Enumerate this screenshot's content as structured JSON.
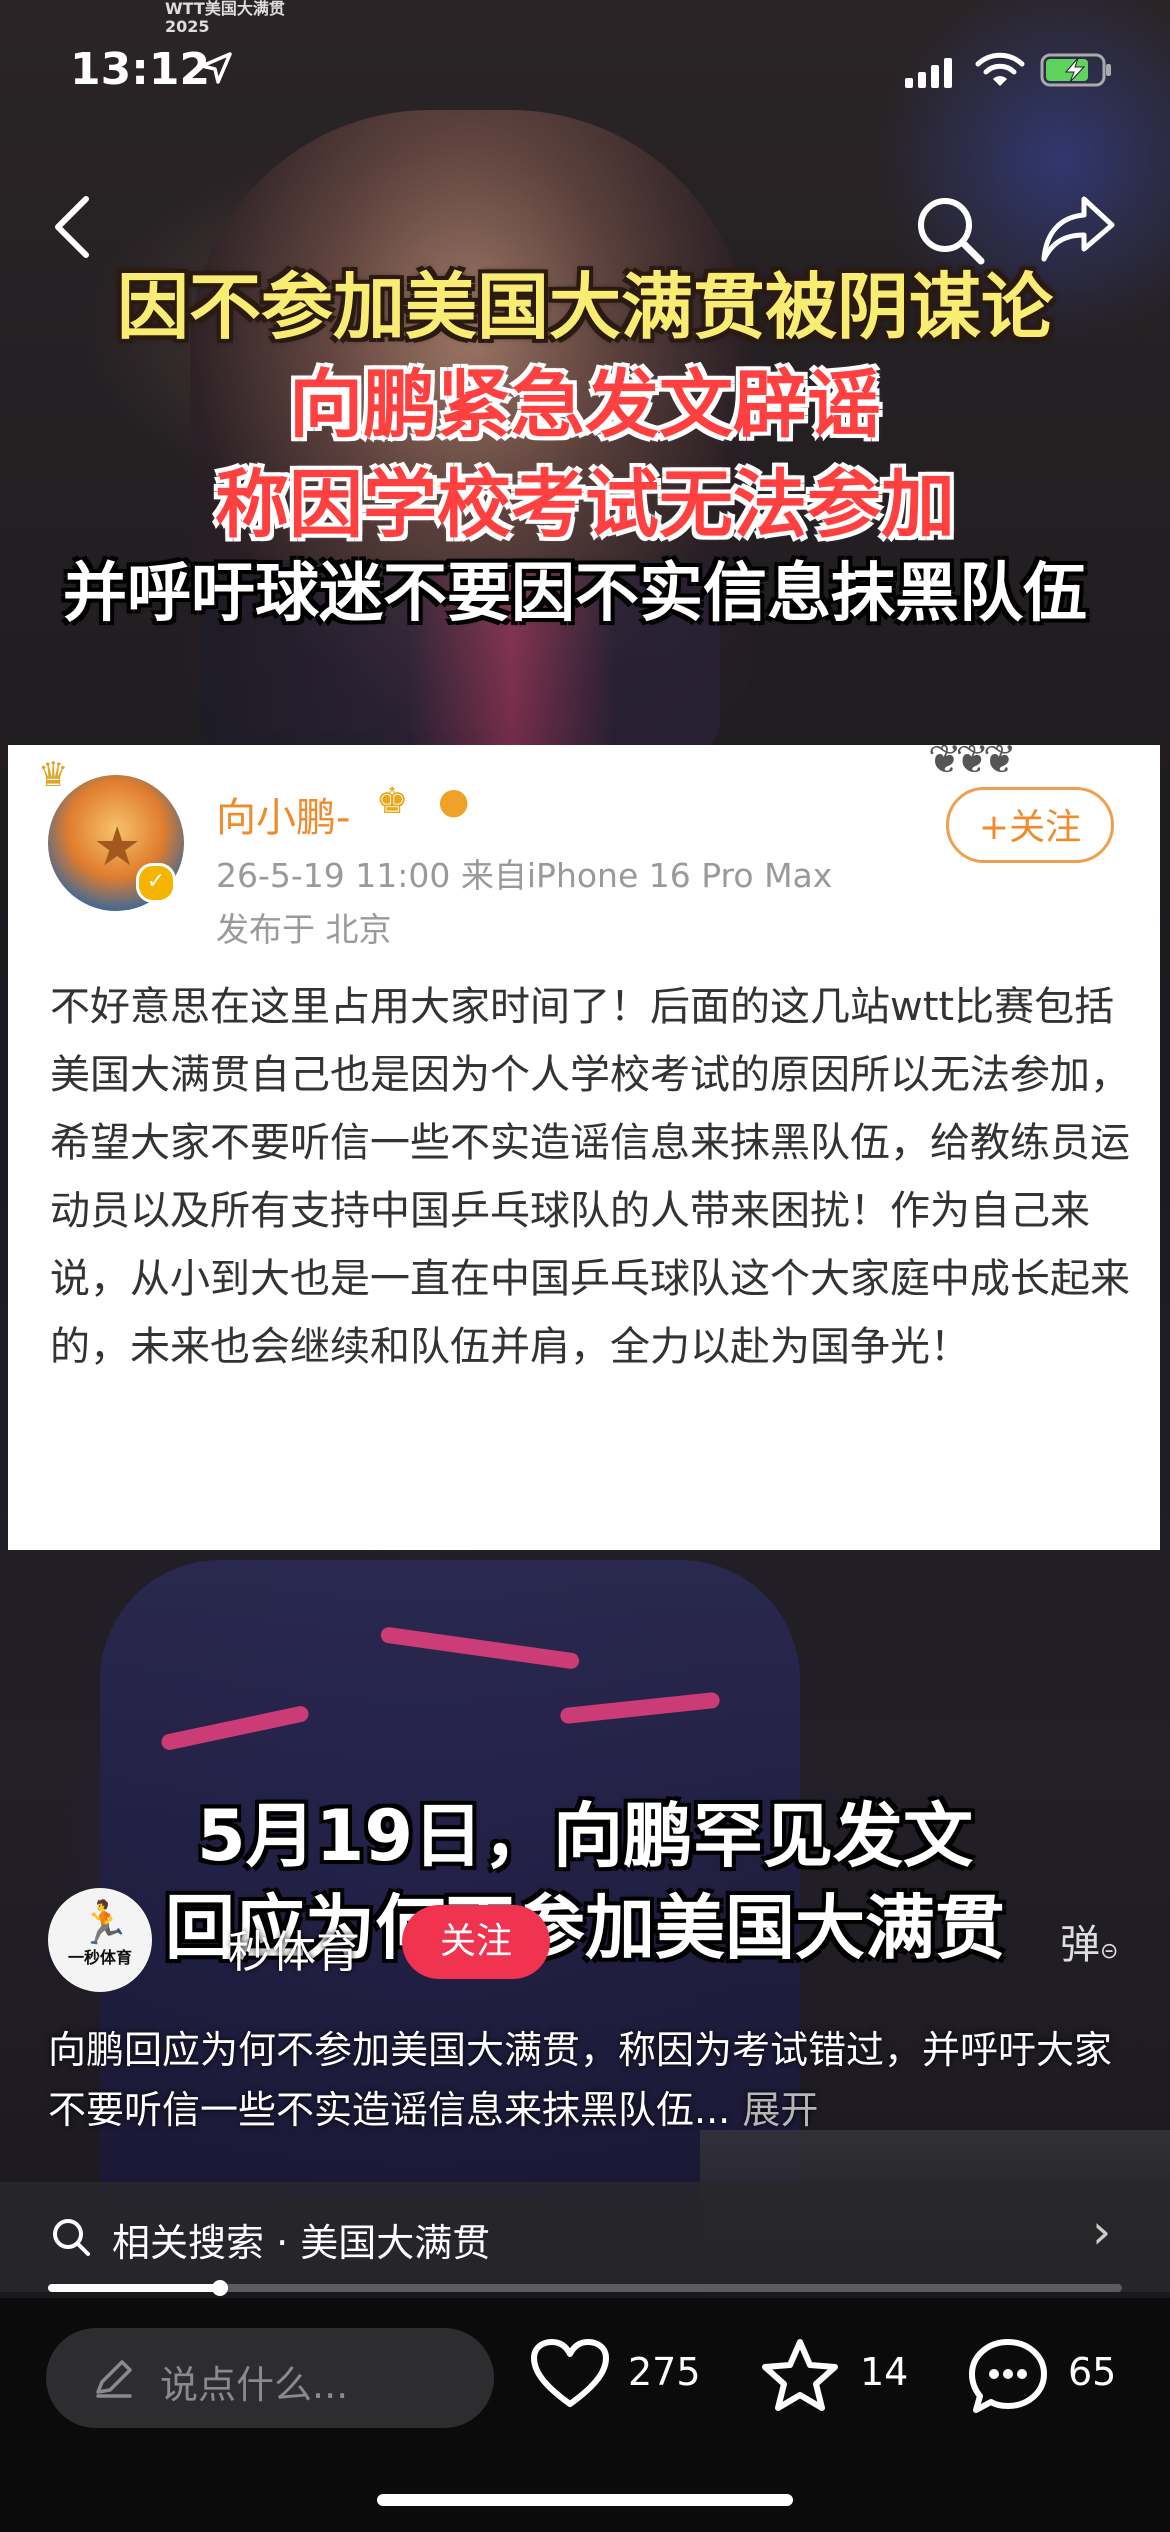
{
  "status_bar": {
    "time": "13:12",
    "top_logo_line1": "WTT美国大满贯",
    "top_logo_line2": "2025"
  },
  "nav": {
    "back_icon": "chevron-left-icon",
    "search_icon": "search-icon",
    "share_icon": "share-icon"
  },
  "video_headline": {
    "line1": "因不参加美国大满贯被阴谋论",
    "line2": "向鹏紧急发文辟谣",
    "line3": "称因学校考试无法参加",
    "line4": "并呼吁球迷不要因不实信息抹黑队伍"
  },
  "post_card": {
    "author": "向小鹏-",
    "timestamp": "26-5-19 11:00  来自iPhone 16 Pro Max",
    "location": "发布于 北京",
    "follow_label": "+关注",
    "body": "不好意思在这里占用大家时间了！后面的这几站wtt比赛包括美国大满贯自己也是因为个人学校考试的原因所以无法参加，希望大家不要听信一些不实造谣信息来抹黑队伍，给教练员运动员以及所有支持中国乒乓球队的人带来困扰！作为自己来说，从小到大也是一直在中国乒乓球队这个大家庭中成长起来的，未来也会继续和队伍并肩，全力以赴为国争光！"
  },
  "video_caption": {
    "line1": "5月19日，向鹏罕见发文",
    "line2": "回应为何不参加美国大满贯"
  },
  "author": {
    "avatar_text": "一秒体育",
    "name": "秒体育",
    "follow_label": "关注",
    "danmu_label": "弹"
  },
  "description": {
    "text": "向鹏回应为何不参加美国大满贯，称因为考试错过，并呼吁大家不要听信一些不实造谣信息来抹黑队伍...",
    "more_label": "展开"
  },
  "related_search": {
    "label": "相关搜索 · 美国大满贯"
  },
  "playback": {
    "progress": 0.16
  },
  "bottom_bar": {
    "comment_placeholder": "说点什么...",
    "likes": "275",
    "favorites": "14",
    "comments": "65"
  }
}
